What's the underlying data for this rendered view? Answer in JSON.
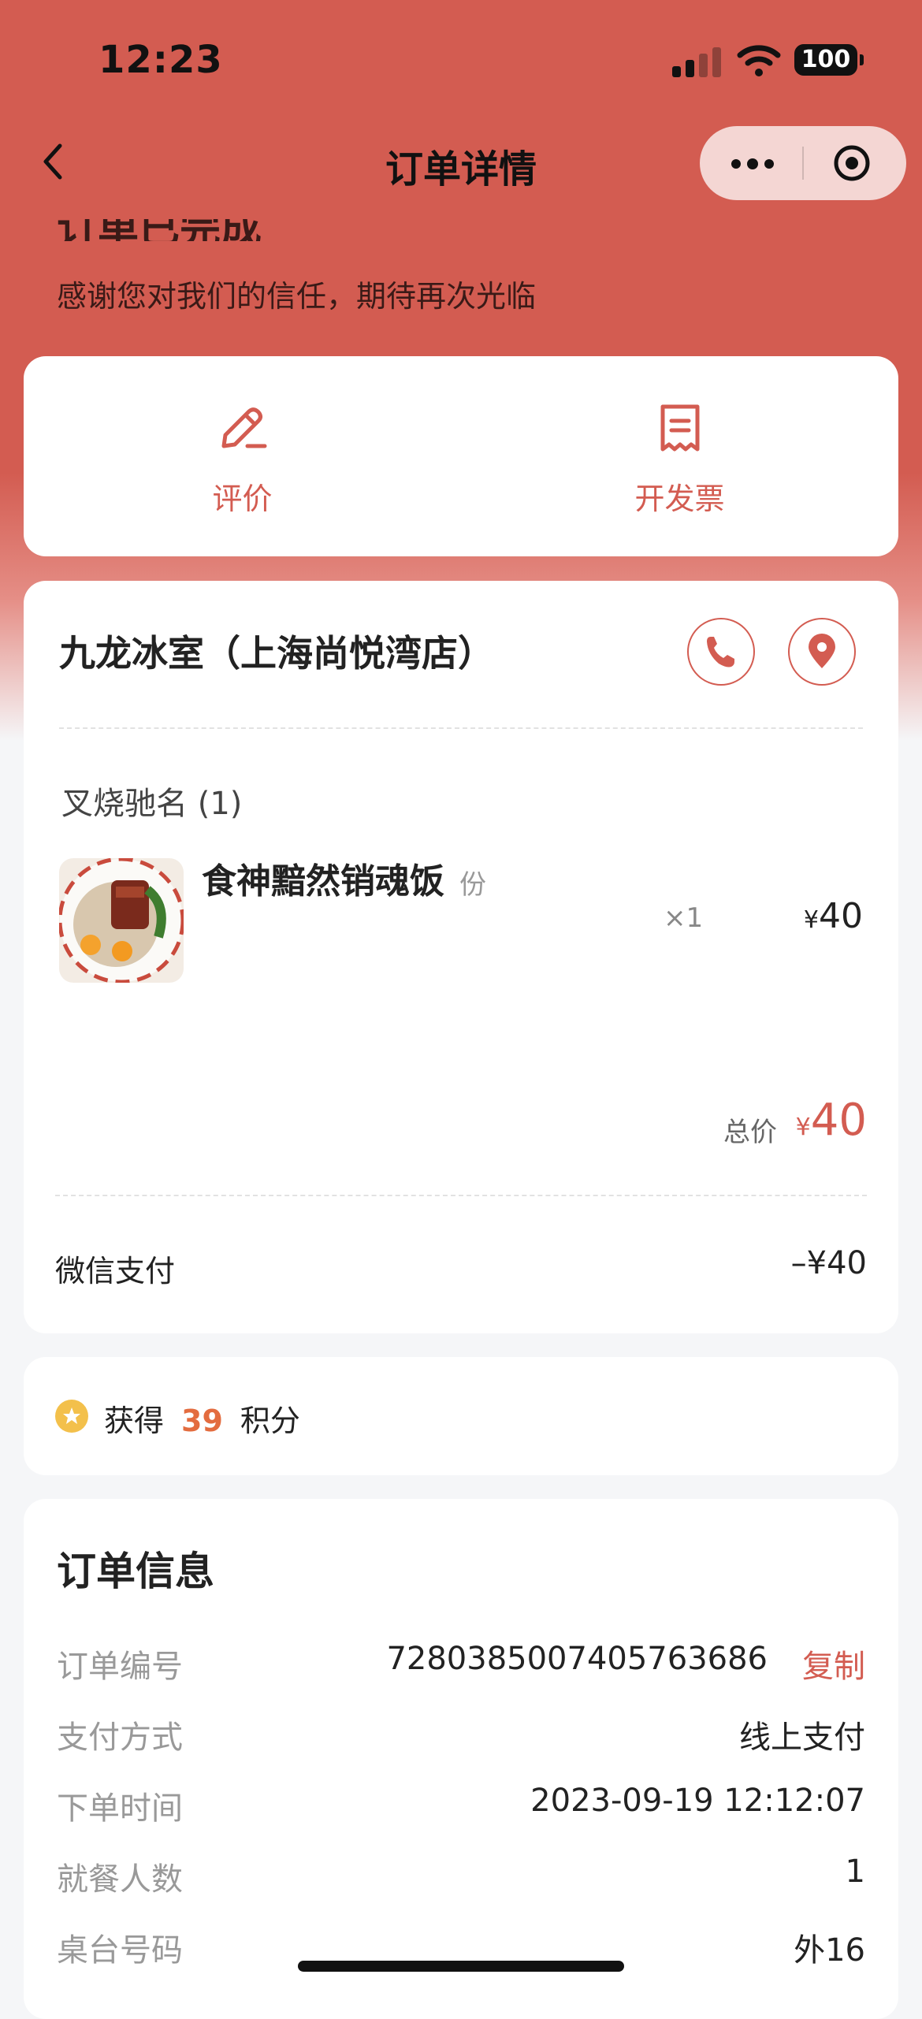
{
  "status_bar": {
    "time": "12:23",
    "battery": "100"
  },
  "nav": {
    "title": "订单详情"
  },
  "order": {
    "status": "订单已完成",
    "subtitle": "感谢您对我们的信任，期待再次光临"
  },
  "actions": [
    {
      "label": "评价",
      "icon": "edit-pencil-icon"
    },
    {
      "label": "开发票",
      "icon": "receipt-icon"
    }
  ],
  "store": {
    "name": "九龙冰室（上海尚悦湾店）",
    "category": "叉烧驰名 (1)",
    "item": {
      "name": "食神黯然销魂饭",
      "unit": "份",
      "quantity": "×1",
      "currency": "¥",
      "price": "40"
    },
    "total_label": "总价",
    "total_currency": "¥",
    "total": "40",
    "payment_method_label": "微信支付",
    "payment_amount": "–¥40"
  },
  "points": {
    "prefix": "获得",
    "value": "39",
    "suffix": "积分"
  },
  "order_info": {
    "title": "订单信息",
    "copy_label": "复制",
    "rows": [
      {
        "label": "订单编号",
        "value": "7280385007405763686"
      },
      {
        "label": "支付方式",
        "value": "线上支付"
      },
      {
        "label": "下单时间",
        "value": "2023-09-19 12:12:07"
      },
      {
        "label": "就餐人数",
        "value": "1"
      },
      {
        "label": "桌台号码",
        "value": "外16"
      }
    ]
  },
  "colors": {
    "brand": "#d35c51",
    "points": "#e36c3f",
    "star": "#f3c04b"
  }
}
